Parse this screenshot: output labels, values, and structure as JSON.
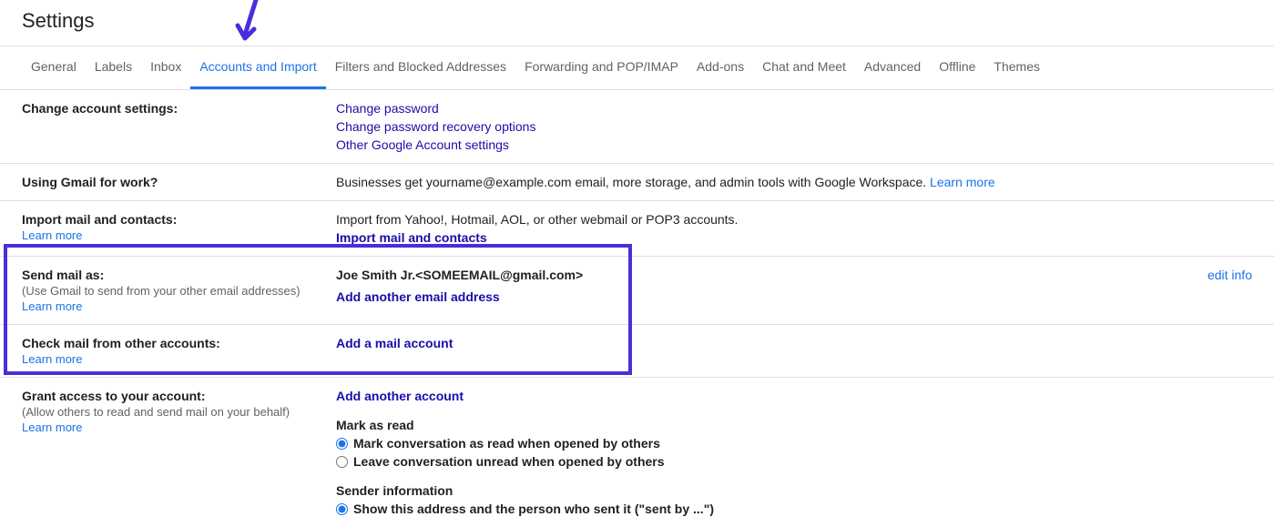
{
  "page_title": "Settings",
  "tabs": [
    "General",
    "Labels",
    "Inbox",
    "Accounts and Import",
    "Filters and Blocked Addresses",
    "Forwarding and POP/IMAP",
    "Add-ons",
    "Chat and Meet",
    "Advanced",
    "Offline",
    "Themes"
  ],
  "active_tab_index": 3,
  "change_account": {
    "title": "Change account settings:",
    "links": [
      "Change password",
      "Change password recovery options",
      "Other Google Account settings"
    ]
  },
  "work": {
    "title": "Using Gmail for work?",
    "desc_prefix": "Businesses get yourname@example.com email, more storage, and admin tools with Google Workspace. ",
    "learn": "Learn more"
  },
  "import": {
    "title": "Import mail and contacts:",
    "desc": "Import from Yahoo!, Hotmail, AOL, or other webmail or POP3 accounts.",
    "learn": "Learn more",
    "action": "Import mail and contacts"
  },
  "send_as": {
    "title": "Send mail as:",
    "sub": "(Use Gmail to send from your other email addresses)",
    "learn": "Learn more",
    "identity": "Joe Smith Jr.<SOMEEMAIL@gmail.com>",
    "action": "Add another email address",
    "edit": "edit info"
  },
  "check_mail": {
    "title": "Check mail from other accounts:",
    "learn": "Learn more",
    "action": "Add a mail account"
  },
  "grant": {
    "title": "Grant access to your account:",
    "sub": "(Allow others to read and send mail on your behalf)",
    "learn": "Learn more",
    "action": "Add another account",
    "mark_heading": "Mark as read",
    "mark_opt1": "Mark conversation as read when opened by others",
    "mark_opt2": "Leave conversation unread when opened by others",
    "sender_heading": "Sender information",
    "sender_opt1": "Show this address and the person who sent it (\"sent by ...\")"
  },
  "annotation": {
    "arrow_color": "#4d2cdb",
    "highlight_color": "#4d2cdb"
  }
}
